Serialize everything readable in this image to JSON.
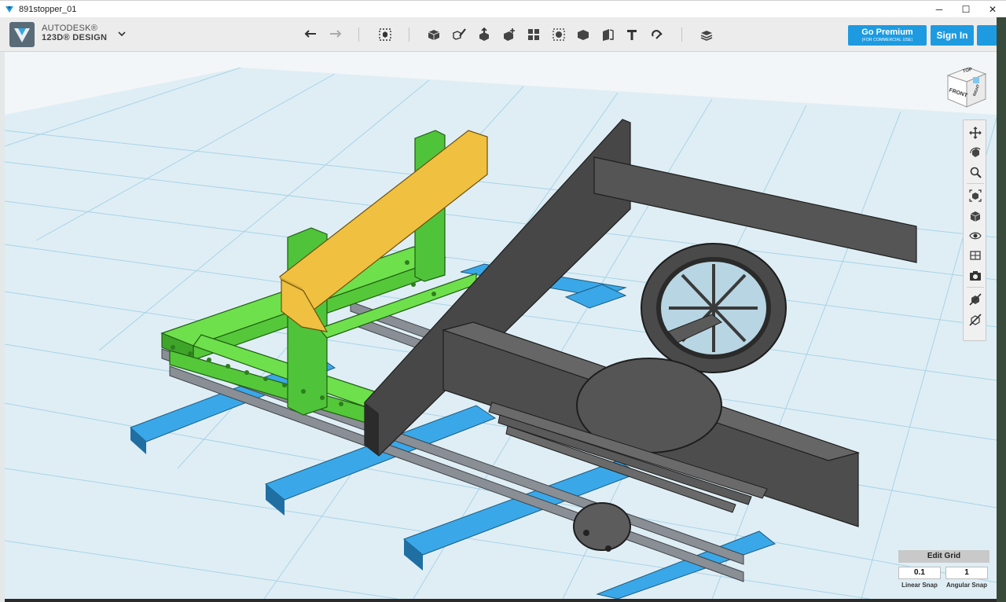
{
  "window": {
    "title": "891stopper_01",
    "controls": [
      "─",
      "☐",
      "✕"
    ]
  },
  "brand": {
    "line1": "AUTODESK®",
    "line2": "123D® DESIGN"
  },
  "toolbar": {
    "icons": [
      "undo-icon",
      "redo-icon",
      "transform-icon",
      "primitives-icon",
      "sketch-icon",
      "construct-icon",
      "modify-icon",
      "pattern-icon",
      "group-icon",
      "combine-icon",
      "measure-icon",
      "text-icon",
      "snap-icon",
      "materials-icon"
    ],
    "premium_label": "Go Premium",
    "premium_sub": "(FOR COMMERCIAL USE)",
    "signin_label": "Sign In"
  },
  "viewcube": {
    "top_label": "TOP",
    "front_label": "FRONT",
    "right_label": "RIGHT"
  },
  "navbar": {
    "icons": [
      "pan-icon",
      "orbit-icon",
      "zoom-icon",
      "fit-icon",
      "view-cube-icon",
      "visibility-icon",
      "materials-outline-icon",
      "screenshot-icon",
      "hide-icon",
      "materials-toggle-icon"
    ]
  },
  "grid_panel": {
    "title": "Edit Grid",
    "linear_value": "0.1",
    "angular_value": "1",
    "linear_label": "Linear Snap",
    "angular_label": "Angular Snap"
  },
  "colors": {
    "accent": "#1e9be0",
    "sleeper": "#3aa8e8",
    "stopper_frame": "#55d43a",
    "beam": "#f0c040",
    "chassis": "#505050",
    "grid_line": "#9fcde3"
  }
}
